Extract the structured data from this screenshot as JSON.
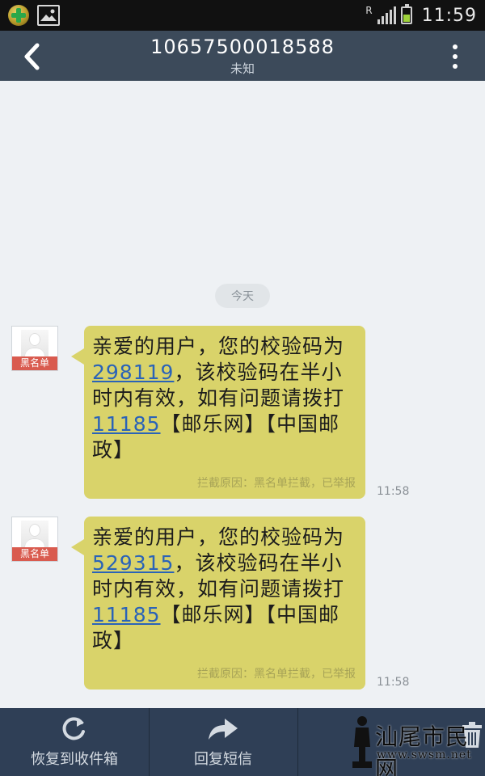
{
  "status_bar": {
    "time": "11:59",
    "roaming": "R"
  },
  "header": {
    "title": "10657500018588",
    "subtitle": "未知"
  },
  "conversation": {
    "date_label": "今天",
    "messages": [
      {
        "avatar_tag": "黑名单",
        "text_before_code": "亲爱的用户，您的校验码为",
        "code": "298119",
        "text_after_code": "，该校验码在半小时内有效，如有问题请拨打",
        "phone": "11185",
        "text_after_phone": "【邮乐网】【中国邮政】",
        "blocked_reason": "拦截原因：黑名单拦截，已举报",
        "time": "11:58"
      },
      {
        "avatar_tag": "黑名单",
        "text_before_code": "亲爱的用户，您的校验码为",
        "code": "529315",
        "text_after_code": "，该校验码在半小时内有效，如有问题请拨打",
        "phone": "11185",
        "text_after_phone": "【邮乐网】【中国邮政】",
        "blocked_reason": "拦截原因：黑名单拦截，已举报",
        "time": "11:58"
      }
    ]
  },
  "bottom_bar": {
    "restore_label": "恢复到收件箱",
    "reply_label": "回复短信"
  },
  "watermark": {
    "name": "汕尾市民网",
    "url": "www.swsm.net"
  },
  "colors": {
    "header_bg": "#3c4a5a",
    "bubble_bg": "#d9d36a",
    "link": "#2a63b8",
    "bottom_bg": "#2f3f56",
    "blacklist_tag": "#d95b4f"
  }
}
